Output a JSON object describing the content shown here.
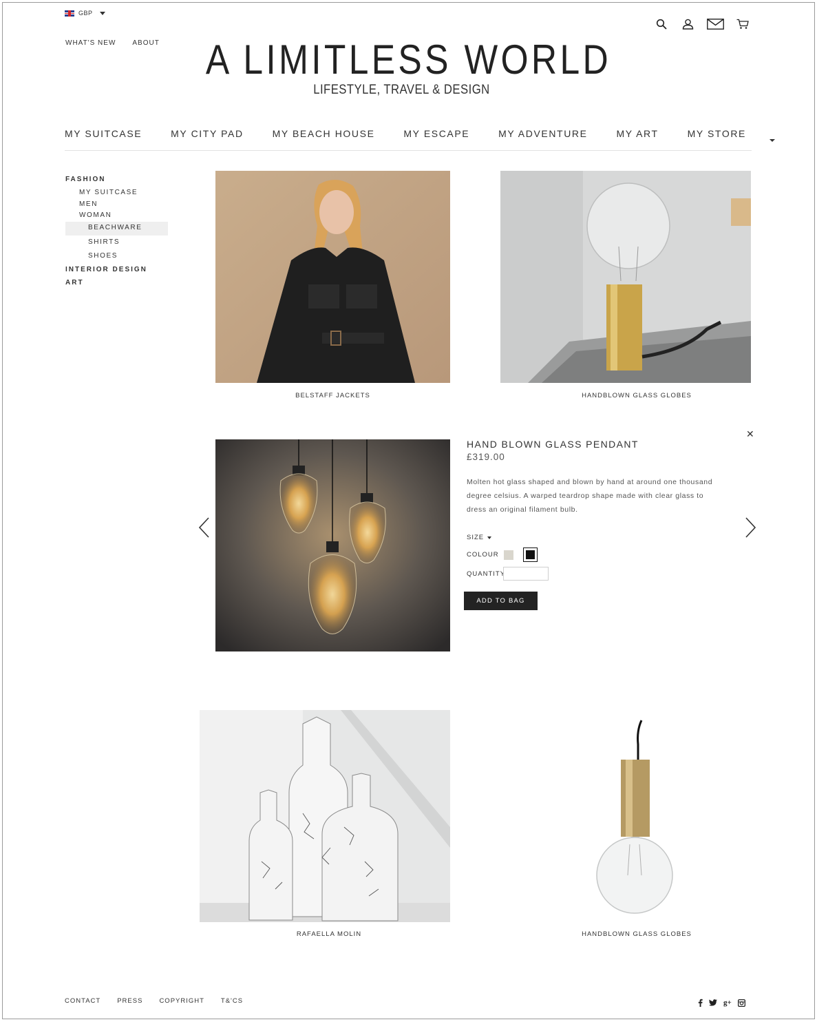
{
  "currency": {
    "code": "GBP",
    "flag_icon": "uk-flag-icon"
  },
  "top_nav": [
    "WHAT'S NEW",
    "ABOUT"
  ],
  "header_icons": [
    "search-icon",
    "user-icon",
    "mail-icon",
    "cart-icon"
  ],
  "brand": {
    "title": "A LIMITLESS WORLD",
    "tagline": "LIFESTYLE, TRAVEL & DESIGN"
  },
  "main_nav": [
    "MY SUITCASE",
    "MY CITY PAD",
    "MY BEACH HOUSE",
    "MY ESCAPE",
    "MY ADVENTURE",
    "MY ART",
    "MY STORE"
  ],
  "sidebar": {
    "fashion": "FASHION",
    "fashion_items": [
      "MY SUITCASE",
      "MEN",
      "WOMAN"
    ],
    "woman_items": [
      "BEACHWARE",
      "SHIRTS",
      "SHOES"
    ],
    "interior_design": "INTERIOR DESIGN",
    "art": "ART"
  },
  "tiles": [
    {
      "caption": "BELSTAFF JACKETS"
    },
    {
      "caption": "HANDBLOWN GLASS GLOBES"
    },
    {
      "caption": "RAFAELLA MOLIN"
    },
    {
      "caption": "HANDBLOWN GLASS GLOBES"
    }
  ],
  "product_detail": {
    "title": "HAND BLOWN GLASS PENDANT",
    "price": "£319.00",
    "description": "Molten hot glass shaped and blown by hand at around one thousand degree celsius. A warped teardrop shape made with clear glass to dress an original filament bulb.",
    "size_label": "SIZE",
    "colour_label": "COLOUR",
    "colours": [
      "#d9d6cd",
      "#111111"
    ],
    "selected_colour": "#111111",
    "quantity_label": "QUANTITY",
    "quantity_value": "",
    "add_button": "ADD TO BAG",
    "close_icon": "close-icon"
  },
  "footer": {
    "links": [
      "CONTACT",
      "PRESS",
      "COPYRIGHT",
      "T&'CS"
    ],
    "social": [
      "f",
      "t",
      "g+",
      "ig"
    ]
  }
}
